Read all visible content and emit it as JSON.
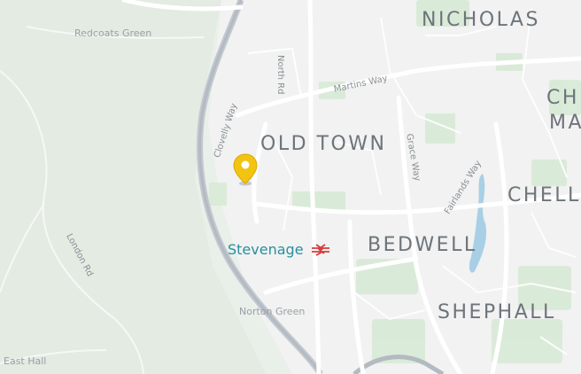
{
  "map": {
    "districts": {
      "st_nicholas": "NICHOLAS",
      "old_town": "OLD TOWN",
      "bedwell": "BEDWELL",
      "shephall": "SHEPHALL",
      "chells": "CHELL",
      "chells_manor_1": "CH",
      "chells_manor_2": "MA"
    },
    "places": {
      "redcoats_green": "Redcoats Green",
      "norton_green": "Norton Green",
      "east_hall": "East Hall",
      "stevenage": "Stevenage"
    },
    "roads": {
      "north_rd": "North Rd",
      "martins_way": "Martins Way",
      "clovelly_way": "Clovelly Way",
      "grace_way": "Grace Way",
      "fairlands_way": "Fairlands Way",
      "london_rd": "London Rd"
    },
    "marker": {
      "icon": "location-pin-icon",
      "color": "#f2c40f"
    },
    "colors": {
      "background": "#e9efe9",
      "urban": "#f2f3f2",
      "green": "#d6ead6",
      "water": "#a9cfe6",
      "motorway": "#b8bec6",
      "station_text": "#2a8fa0",
      "rail_icon": "#d93b3b"
    }
  }
}
